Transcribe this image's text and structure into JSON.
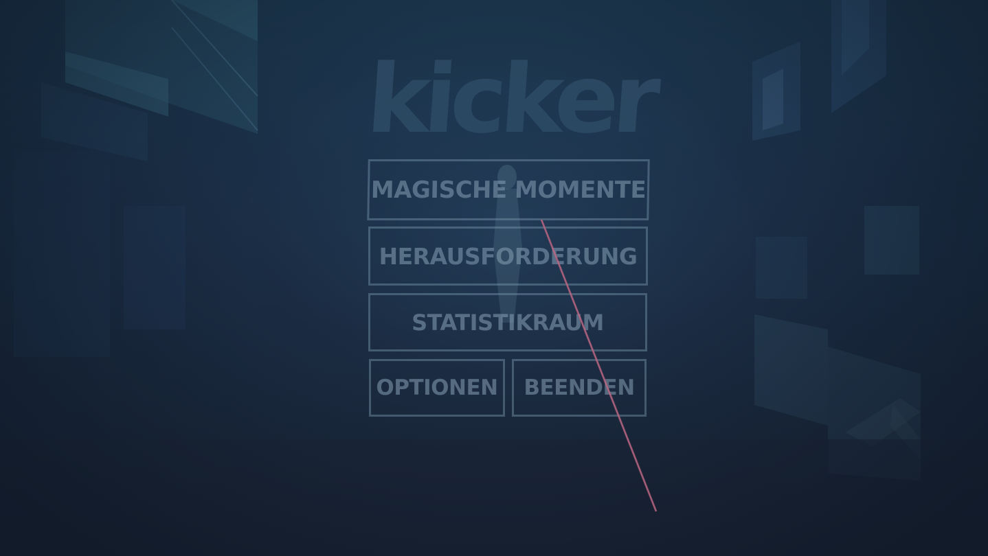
{
  "logo": {
    "text": "kicker"
  },
  "menu": {
    "magic_moments": "MAGISCHE MOMENTE",
    "challenge": "HERAUSFORDERUNG",
    "stats_room": "STATISTIKRAUM",
    "options": "OPTIONEN",
    "quit": "BEENDEN"
  },
  "colors": {
    "background_top": "#1d3a52",
    "background_bottom": "#1a2638",
    "button_border": "#7896aa",
    "logo": "#2d4a64",
    "pointer_ray": "#b05a78"
  }
}
